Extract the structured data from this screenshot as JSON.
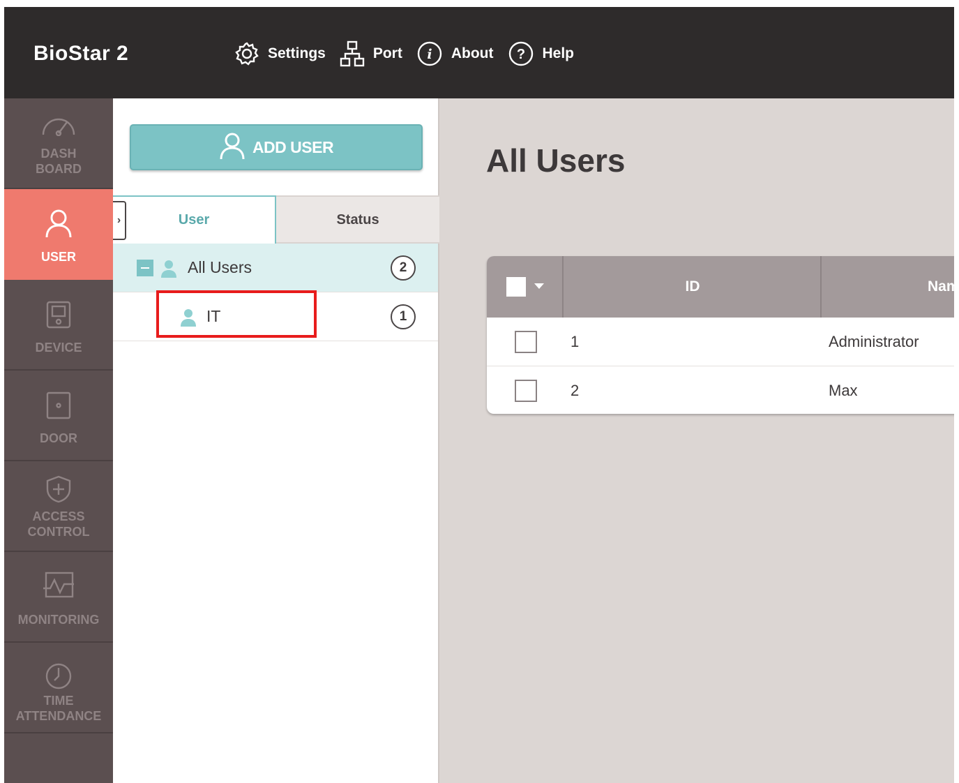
{
  "app": {
    "title": "BioStar 2"
  },
  "topnav": {
    "settings": "Settings",
    "port": "Port",
    "about": "About",
    "help": "Help"
  },
  "sidebar": {
    "items": [
      {
        "label1": "DASH",
        "label2": "BOARD",
        "icon": "gauge-icon",
        "active": false
      },
      {
        "label1": "USER",
        "label2": "",
        "icon": "user-icon",
        "active": true
      },
      {
        "label1": "DEVICE",
        "label2": "",
        "icon": "device-icon",
        "active": false
      },
      {
        "label1": "DOOR",
        "label2": "",
        "icon": "door-icon",
        "active": false
      },
      {
        "label1": "ACCESS",
        "label2": "CONTROL",
        "icon": "shield-plus-icon",
        "active": false
      },
      {
        "label1": "MONITORING",
        "label2": "",
        "icon": "monitoring-icon",
        "active": false
      },
      {
        "label1": "TIME",
        "label2": "ATTENDANCE",
        "icon": "clock-icon",
        "active": false
      }
    ]
  },
  "tree": {
    "add_button": "ADD USER",
    "tabs": {
      "user": "User",
      "status": "Status"
    },
    "groups": [
      {
        "name": "All Users",
        "count": "2"
      },
      {
        "name": "IT",
        "count": "1"
      }
    ]
  },
  "main": {
    "title": "All Users",
    "columns": {
      "id": "ID",
      "name": "Name"
    },
    "rows": [
      {
        "id": "1",
        "name": "Administrator"
      },
      {
        "id": "2",
        "name": "Max"
      }
    ]
  },
  "colors": {
    "topbar": "#2e2b2b",
    "sidebar": "#5b4f50",
    "active": "#ef7a6e",
    "accent": "#7cc3c5",
    "highlight": "#e81c1c"
  }
}
